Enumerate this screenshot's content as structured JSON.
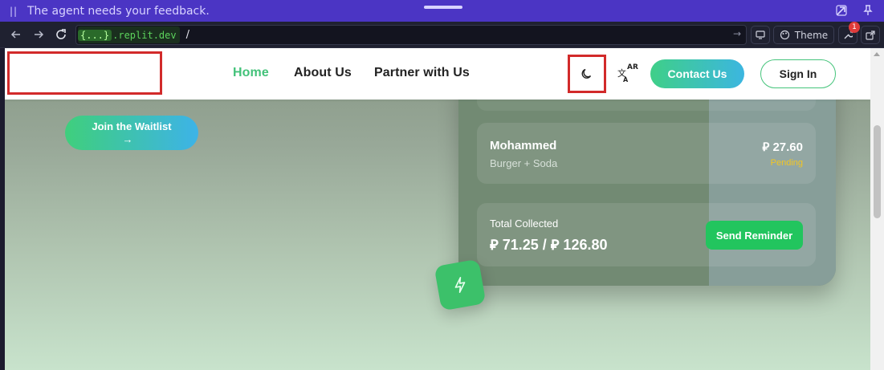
{
  "agent_bar": {
    "message": "The agent needs your feedback.",
    "pause_icon": "pause-icon",
    "expand_icon": "open-external-icon",
    "pin_icon": "pin-icon"
  },
  "browser": {
    "url_host_prefix": "{...}",
    "url_host": ".replit.dev",
    "url_path": "/",
    "theme_label": "Theme",
    "notification_count": "1",
    "icons": [
      "back-icon",
      "forward-icon",
      "reload-icon",
      "go-icon",
      "device-icon",
      "palette-icon",
      "wrench-icon",
      "external-link-icon"
    ]
  },
  "site": {
    "nav": {
      "home": "Home",
      "about": "About Us",
      "partner": "Partner with Us"
    },
    "theme_toggle_icon": "moon-icon",
    "language_icon": "translate-icon",
    "language_label": "AR",
    "contact_label": "Contact Us",
    "signin_label": "Sign In",
    "waitlist_label": "Join the Waitlist",
    "waitlist_arrow": "→"
  },
  "card": {
    "order": {
      "name": "Mohammed",
      "item": "Burger + Soda",
      "amount": "⃁ 27.60",
      "status": "Pending"
    },
    "total": {
      "label": "Total Collected",
      "value": "⃁ 71.25 / ⃁ 126.80",
      "reminder_label": "Send Reminder"
    },
    "badge_icon": "bolt-icon"
  },
  "colors": {
    "agent_bar": "#4b35c4",
    "brand_green": "#43c27a",
    "brand_blue": "#3cb6e0",
    "pending": "#f3c623",
    "highlight_red": "#d22a2a"
  }
}
